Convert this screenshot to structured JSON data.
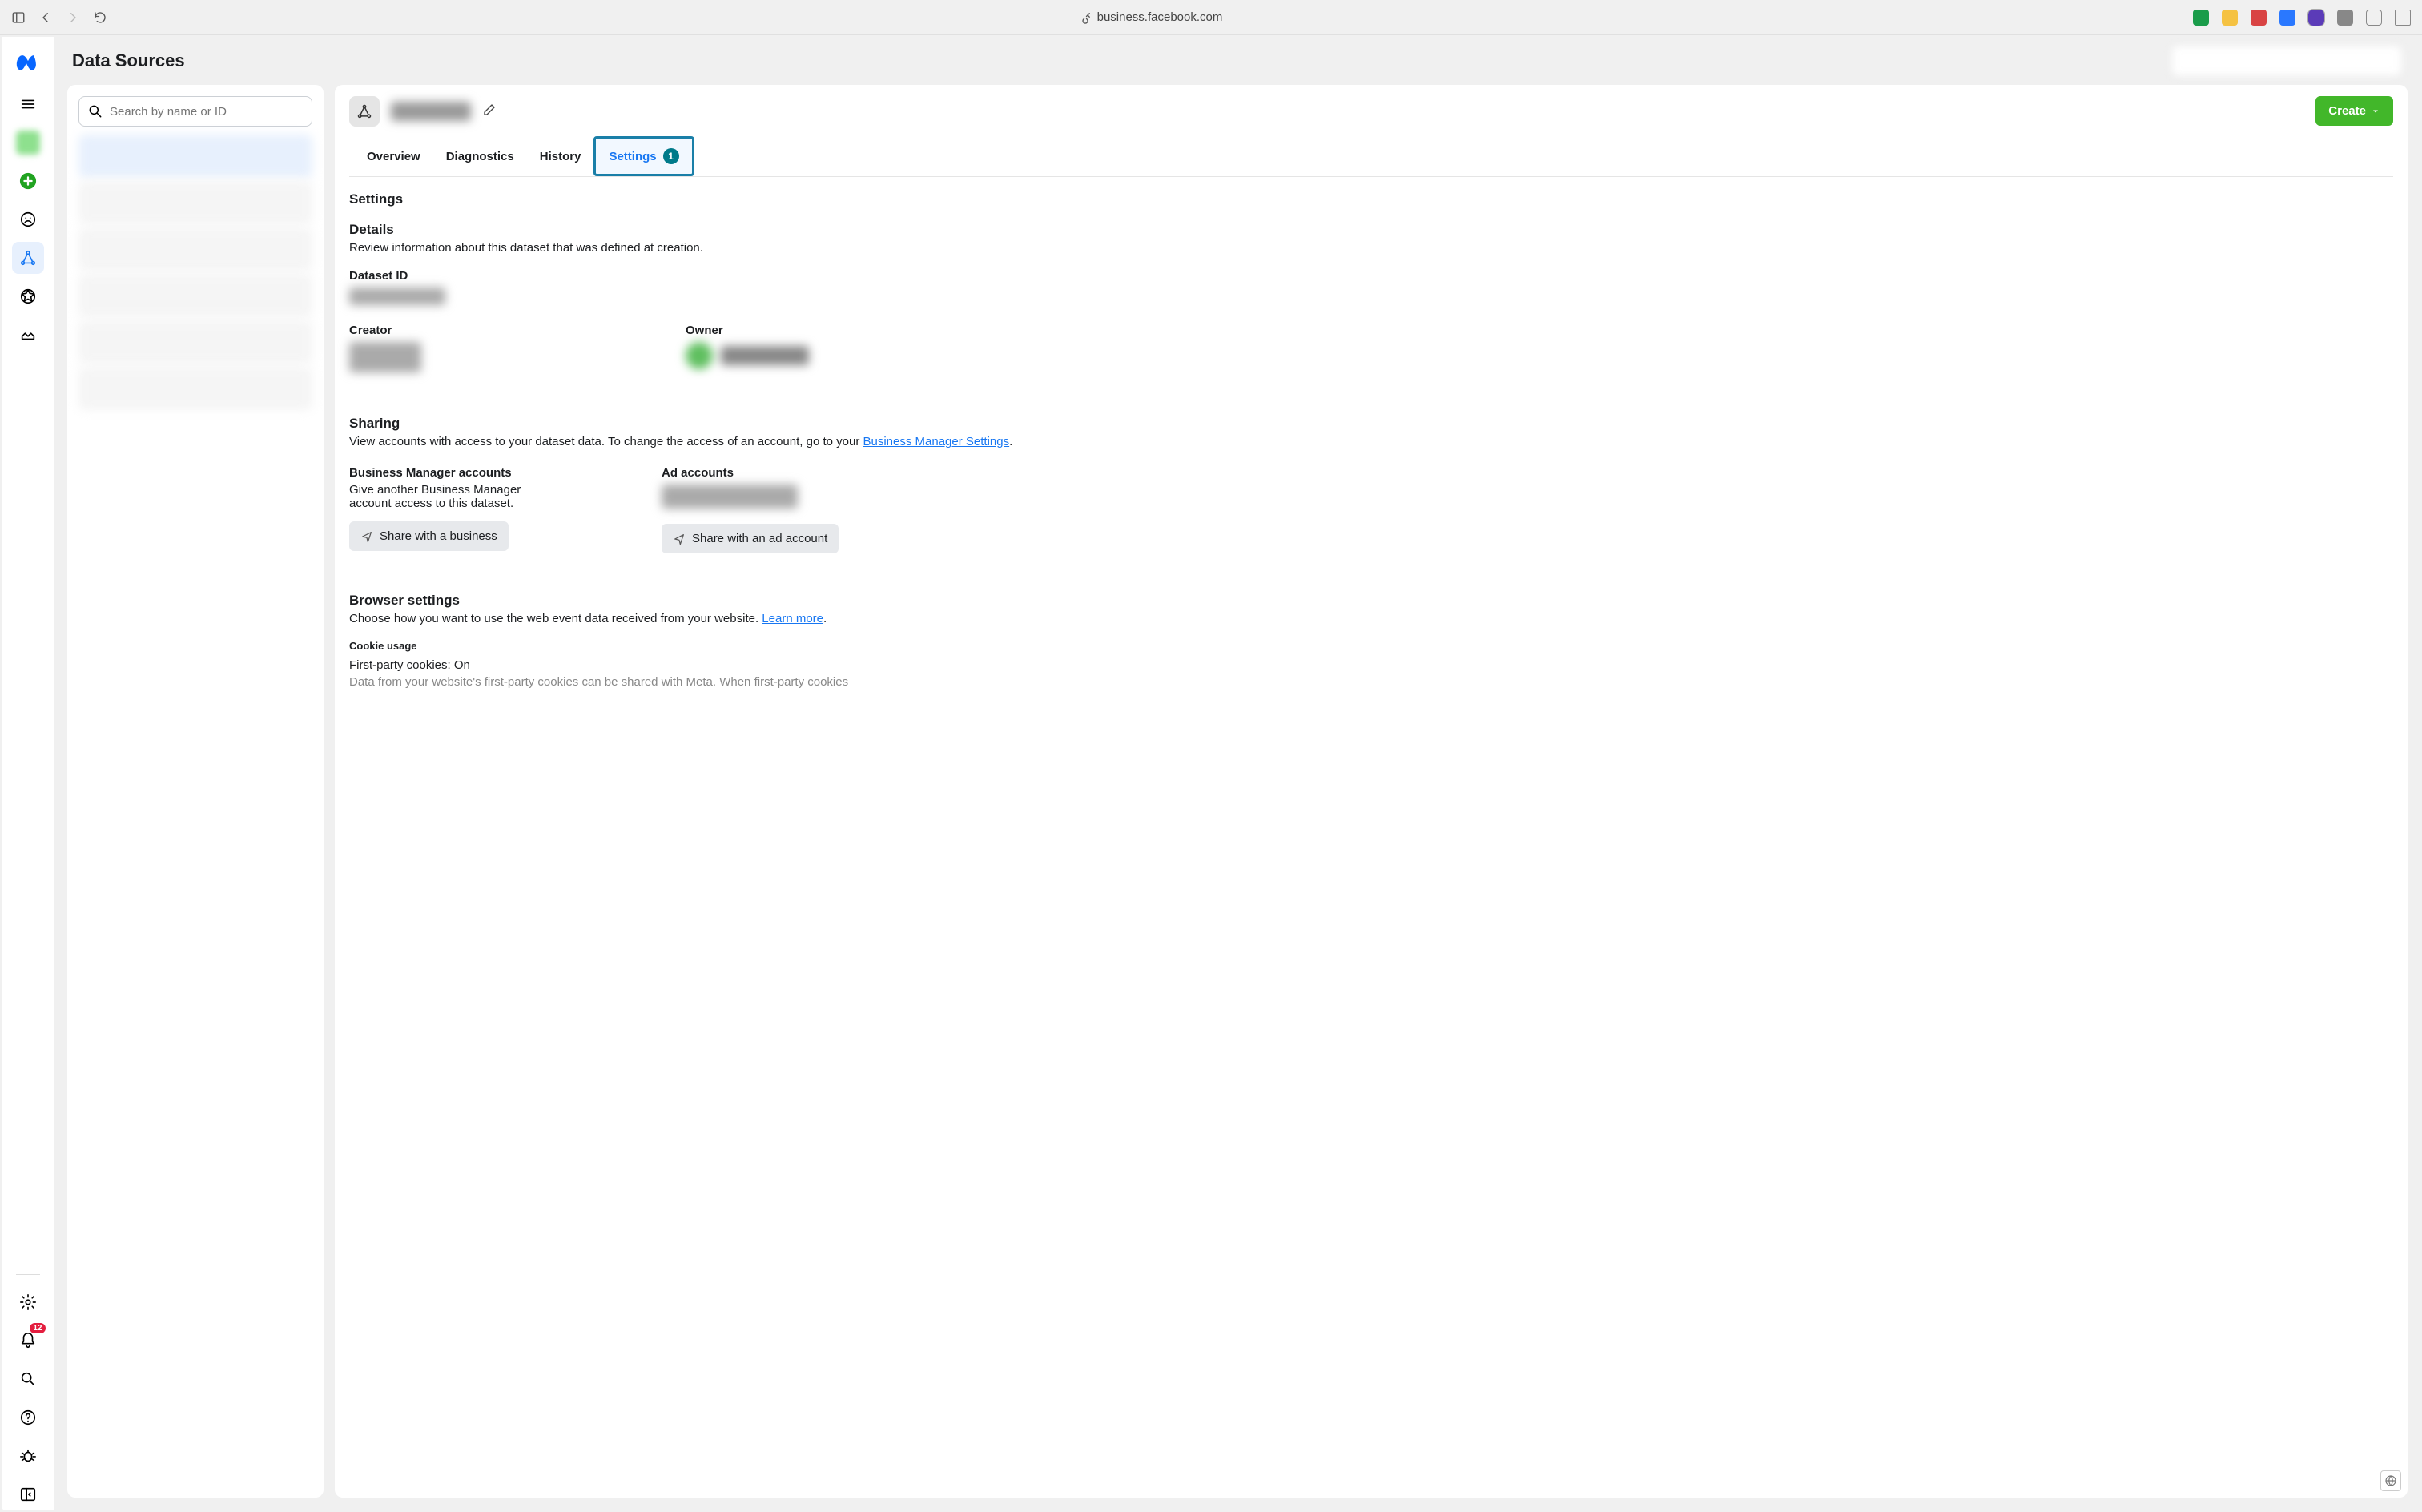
{
  "browser": {
    "url": "business.facebook.com"
  },
  "page": {
    "title": "Data Sources"
  },
  "leftRail": {
    "notifBadge": "12"
  },
  "search": {
    "placeholder": "Search by name or ID"
  },
  "createBtn": {
    "label": "Create"
  },
  "tabs": {
    "overview": "Overview",
    "diagnostics": "Diagnostics",
    "history": "History",
    "settings": "Settings",
    "settingsBadge": "1"
  },
  "settings": {
    "heading": "Settings",
    "details": {
      "title": "Details",
      "desc": "Review information about this dataset that was defined at creation.",
      "datasetIdLabel": "Dataset ID",
      "creatorLabel": "Creator",
      "ownerLabel": "Owner"
    },
    "sharing": {
      "title": "Sharing",
      "descPrefix": "View accounts with access to your dataset data. To change the access of an account, go to your ",
      "linkText": "Business Manager Settings",
      "bmLabel": "Business Manager accounts",
      "bmDesc": "Give another Business Manager account access to this dataset.",
      "bmButton": "Share with a business",
      "adLabel": "Ad accounts",
      "adButton": "Share with an ad account"
    },
    "browser": {
      "title": "Browser settings",
      "descPrefix": "Choose how you want to use the web event data received from your website. ",
      "learnMore": "Learn more",
      "cookieLabel": "Cookie usage",
      "cookieStatus": "First-party cookies: On",
      "cookieCutoff": "Data from your website's first-party cookies can be shared with Meta. When first-party cookies"
    }
  }
}
